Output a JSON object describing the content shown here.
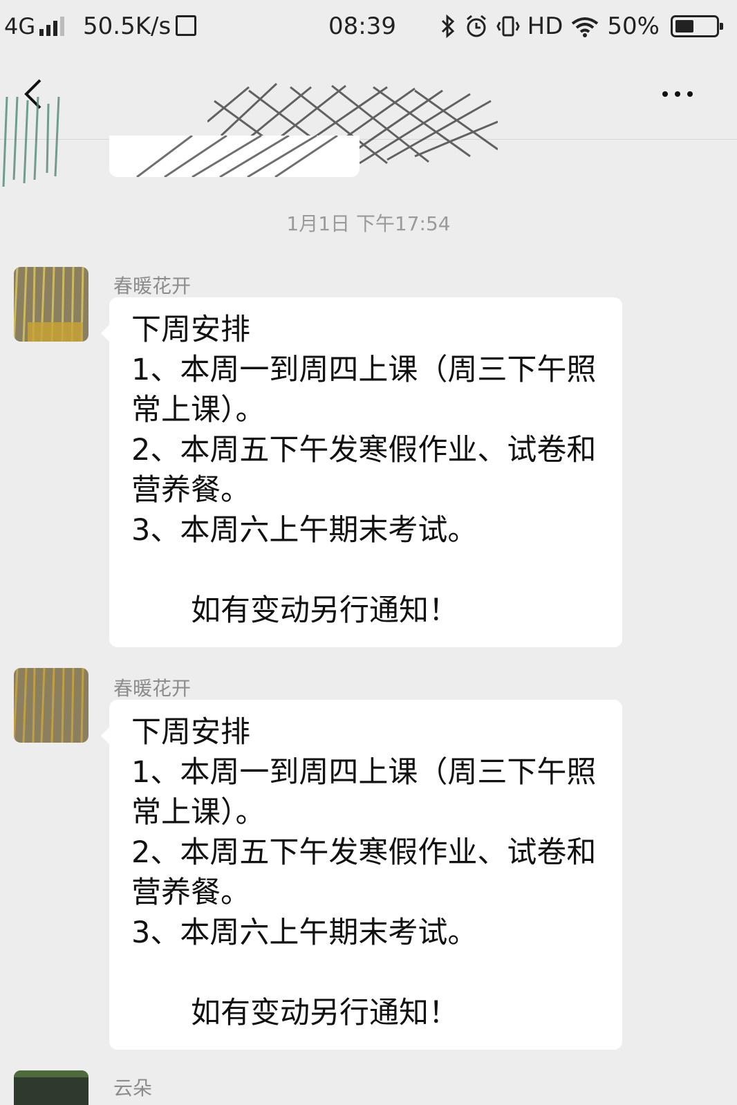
{
  "status_bar": {
    "network": "4G",
    "speed": "50.5K/s",
    "time": "08:39",
    "hd_label": "HD",
    "battery": "50%",
    "battery_level": 0.5
  },
  "nav": {
    "back_icon": "chevron-left-icon",
    "more_icon": "ellipsis-icon"
  },
  "chat": {
    "timestamp": "1月1日 下午17:54",
    "messages": [
      {
        "sender": "春暖花开",
        "text": "下周安排\n1、本周一到周四上课（周三下午照常上课）。\n2、本周五下午发寒假作业、试卷和营养餐。\n3、本周六上午期末考试。\n\n　　如有变动另行通知！"
      },
      {
        "sender": "春暖花开",
        "text": "下周安排\n1、本周一到周四上课（周三下午照常上课）。\n2、本周五下午发寒假作业、试卷和营养餐。\n3、本周六上午期末考试。\n\n　　如有变动另行通知！"
      },
      {
        "sender": "云朵"
      }
    ]
  },
  "colors": {
    "background": "#ededed",
    "bubble": "#ffffff",
    "meta_text": "#9a9a9a"
  }
}
